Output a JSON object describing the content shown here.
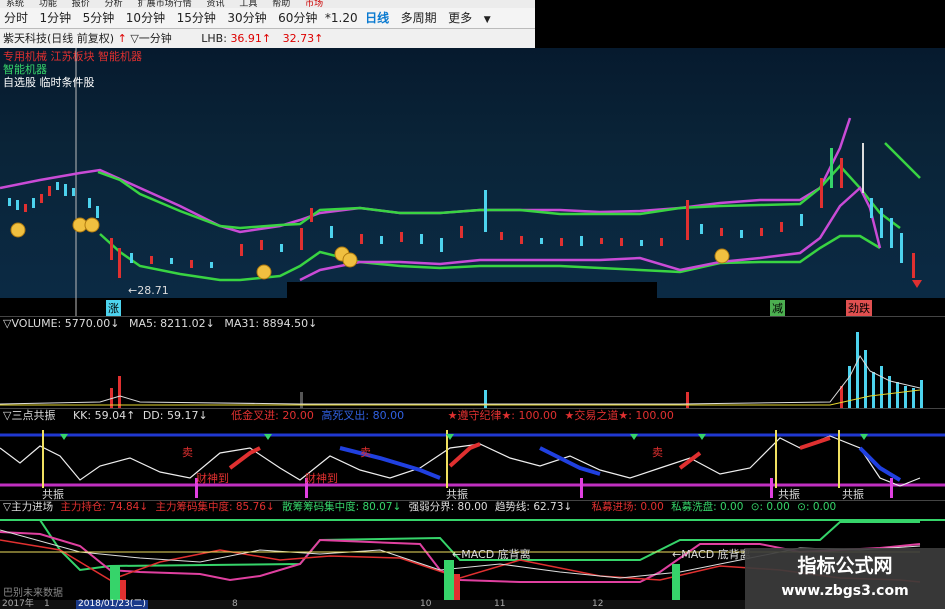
{
  "menu": {
    "items": [
      "系统",
      "功能",
      "报价",
      "分析",
      "扩展市场行情",
      "资讯",
      "工具",
      "帮助",
      "市场"
    ]
  },
  "periods": {
    "items": [
      "分时",
      "1分钟",
      "5分钟",
      "10分钟",
      "15分钟",
      "30分钟",
      "60分钟",
      "日线",
      "多周期",
      "更多"
    ],
    "extra": "*1.20"
  },
  "title": {
    "stock": "紫天科技(日线 前复权)",
    "tool": "▽一分钟",
    "lhb_label": "LHB:",
    "val1": "36.91↑",
    "val2": "32.73↑"
  },
  "tags": {
    "line1": "专用机械 江苏板块 智能机器",
    "line2": "智能机器",
    "line3": "自选股 临时条件股"
  },
  "main_chart": {
    "low_label": "←28.71",
    "bottom_tags": [
      "涨",
      "减",
      "劲跌"
    ]
  },
  "volume": {
    "name": "▽VOLUME:",
    "v": "5770.00↓",
    "ma5": "MA5: 8211.02↓",
    "ma31": "MA31: 8894.50↓"
  },
  "sandian": {
    "name": "▽三点共振",
    "kk": "KK: 59.04↑",
    "dd": "DD: 59.17↓",
    "buy": "低金叉进: 20.00",
    "sell": "高死叉出: 80.00",
    "s1": "★遵守纪律★: 100.00",
    "s2": "★交易之道★: 100.00",
    "labels": {
      "gongzhen": "共振",
      "mai": "卖",
      "mai2": "买",
      "caishen": "财神到"
    }
  },
  "zhuli": {
    "name": "▽主力进场",
    "a": "主力持仓: 74.84↓",
    "b": "主力筹码集中度: 85.76↓",
    "c": "散筹筹码集中度: 80.07↓",
    "d": "强弱分界: 80.00",
    "e": "趋势线: 62.73↓",
    "f": "私募进场: 0.00",
    "g": "私募洗盘: 0.00",
    "h": "⊙: 0.00",
    "i": "⊙: 0.00",
    "macd1": "←MACD 底背离",
    "macd2": "←MACD 底背离",
    "stub": "巴别未来数据"
  },
  "dates": {
    "d0": "2017年",
    "d1": "1",
    "d2": "2018/01/23(二)",
    "d3": "8",
    "d4": "10",
    "d5": "11",
    "d6": "12"
  },
  "watermark": {
    "line1": "指标公式网",
    "line2": "www.zbgs3.com"
  }
}
